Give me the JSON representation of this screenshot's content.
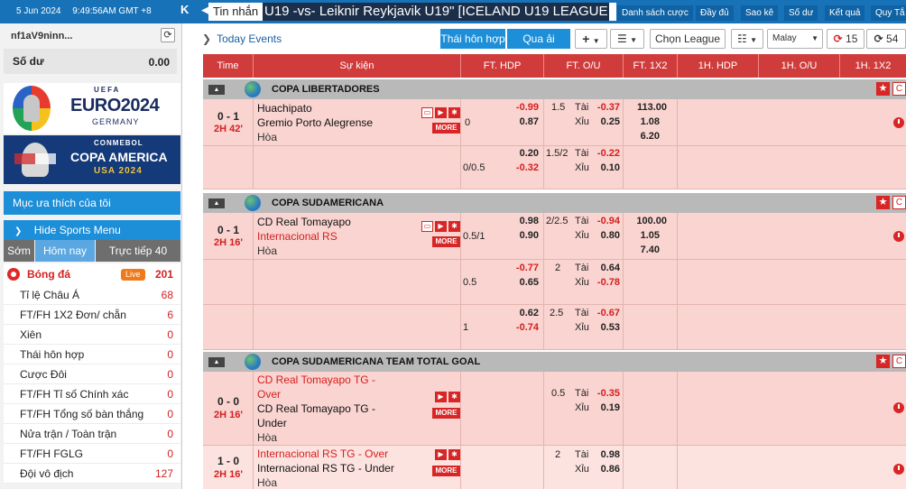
{
  "topbar": {
    "date": "5 Jun 2024",
    "time": "9:49:56AM GMT +8",
    "ticker_label": "Tin nhắn",
    "ticker_text": "U19 -vs- Leiknir Reykjavik U19\" [ICELAND U19 LEAGUE",
    "menu": [
      "Danh sách cược",
      "Đầy đủ",
      "Sao kê",
      "Số dư",
      "Kết quả",
      "Quy Tắ"
    ]
  },
  "sidebar": {
    "username": "nf1aV9ninn...",
    "balance_label": "Số dư",
    "balance_value": "0.00",
    "banner1": {
      "top": "UEFA",
      "main": "EURO2024",
      "sub": "GERMANY"
    },
    "banner2": {
      "top": "CONMEBOL",
      "main": "COPA AMERICA",
      "sub": "USA 2024"
    },
    "favorites": "Mục ưa thích của tôi",
    "hide_menu": "Hide Sports Menu",
    "tabs": [
      "Sớm",
      "Hôm nay",
      "Trực tiếp 40"
    ],
    "sport": {
      "name": "Bóng đá",
      "live": "Live",
      "count": "201"
    },
    "items": [
      {
        "label": "Tỉ lệ Châu Á",
        "count": "68"
      },
      {
        "label": "FT/FH 1X2 Đơn/ chẵn",
        "count": "6"
      },
      {
        "label": "Xiên",
        "count": "0"
      },
      {
        "label": "Thái hôn hợp",
        "count": "0"
      },
      {
        "label": "Cược Đôi",
        "count": "0"
      },
      {
        "label": "FT/FH Tỉ số Chính xác",
        "count": "0"
      },
      {
        "label": "FT/FH Tổng số bàn thắng",
        "count": "0"
      },
      {
        "label": "Nửa trận / Toàn trận",
        "count": "0"
      },
      {
        "label": "FT/FH FGLG",
        "count": "0"
      },
      {
        "label": "Đội vô địch",
        "count": "127"
      }
    ]
  },
  "main": {
    "title": "Today Events",
    "btn_mix": "Thái hôn hợp",
    "btn_pass": "Qua ải",
    "btn_plus": "+",
    "btn_chon": "Chọn League",
    "odds_type": "Malay",
    "refresh1": "15",
    "refresh2": "54",
    "headers": [
      "Time",
      "Sự kiện",
      "FT. HDP",
      "FT. O/U",
      "FT. 1X2",
      "1H. HDP",
      "1H. O/U",
      "1H. 1X2"
    ]
  },
  "leagues": [
    {
      "name": "COPA LIBERTADORES"
    },
    {
      "name": "COPA SUDAMERICANA"
    },
    {
      "name": "COPA SUDAMERICANA TEAM TOTAL GOAL"
    }
  ],
  "events": {
    "e1": {
      "score": "0 - 1",
      "time": "2H 42'",
      "home": "Huachipato",
      "away": "Gremio Porto Alegrense",
      "draw": "Hòa",
      "r1": {
        "hdp": "0",
        "h1": "-0.99",
        "h2": "0.87",
        "ou": "1.5",
        "tai": "Tài",
        "xiu": "Xỉu",
        "o1": "-0.37",
        "o2": "0.25",
        "x1": "113.00",
        "x2": "1.08",
        "x3": "6.20"
      },
      "r2": {
        "hdp": "0/0.5",
        "h1": "0.20",
        "h2": "-0.32",
        "ou": "1.5/2",
        "tai": "Tài",
        "xiu": "Xỉu",
        "o1": "-0.22",
        "o2": "0.10"
      }
    },
    "e2": {
      "score": "0 - 1",
      "time": "2H 16'",
      "home": "CD Real Tomayapo",
      "away": "Internacional RS",
      "draw": "Hòa",
      "r1": {
        "hdp": "0.5/1",
        "h1": "0.98",
        "h2": "0.90",
        "ou": "2/2.5",
        "tai": "Tài",
        "xiu": "Xỉu",
        "o1": "-0.94",
        "o2": "0.80",
        "x1": "100.00",
        "x2": "1.05",
        "x3": "7.40"
      },
      "r2": {
        "hdp": "0.5",
        "h1": "-0.77",
        "h2": "0.65",
        "ou": "2",
        "tai": "Tài",
        "xiu": "Xỉu",
        "o1": "0.64",
        "o2": "-0.78"
      },
      "r3": {
        "hdp": "1",
        "h1": "0.62",
        "h2": "-0.74",
        "ou": "2.5",
        "tai": "Tài",
        "xiu": "Xỉu",
        "o1": "-0.67",
        "o2": "0.53"
      }
    },
    "e3": {
      "score": "0 - 0",
      "time": "2H 16'",
      "home1": "CD Real Tomayapo TG -",
      "home2": "Over",
      "away1": "CD Real Tomayapo TG -",
      "away2": "Under",
      "draw": "Hòa",
      "r1": {
        "ou": "0.5",
        "tai": "Tài",
        "xiu": "Xỉu",
        "o1": "-0.35",
        "o2": "0.19"
      }
    },
    "e4": {
      "score": "1 - 0",
      "time": "2H 16'",
      "home": "Internacional RS TG - Over",
      "away": "Internacional RS TG - Under",
      "draw": "Hòa",
      "r1": {
        "ou": "2",
        "tai": "Tài",
        "xiu": "Xỉu",
        "o1": "0.98",
        "o2": "0.86"
      }
    }
  },
  "labels": {
    "more": "MORE"
  }
}
